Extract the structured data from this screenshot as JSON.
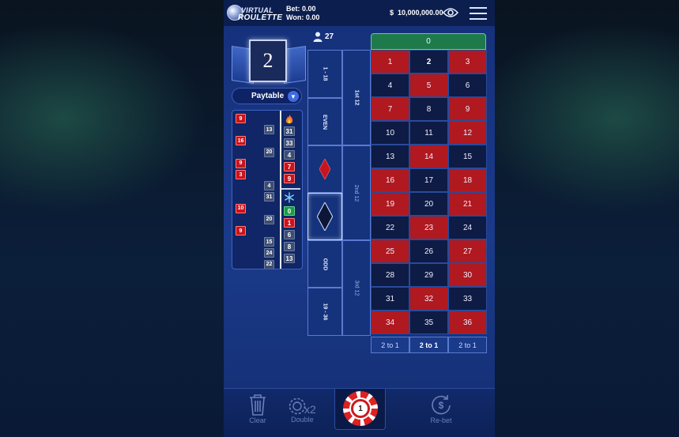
{
  "header": {
    "logo_line1": "VIRTUAL",
    "logo_line2": "ROULETTE",
    "bet_label": "Bet: 0.00",
    "won_label": "Won: 0.00",
    "currency": "$",
    "balance": "10,000,000.00"
  },
  "last_result": "2",
  "paytable_label": "Paytable",
  "players_count": "27",
  "history": [
    {
      "value": "9",
      "color": "red",
      "col": 0
    },
    {
      "value": "13",
      "color": "black",
      "col": 2
    },
    {
      "value": "16",
      "color": "red",
      "col": 0
    },
    {
      "value": "20",
      "color": "black",
      "col": 2
    },
    {
      "value": "9",
      "color": "red",
      "col": 0
    },
    {
      "value": "3",
      "color": "red",
      "col": 0
    },
    {
      "value": "4",
      "color": "black",
      "col": 2
    },
    {
      "value": "31",
      "color": "black",
      "col": 2
    },
    {
      "value": "10",
      "color": "red",
      "col": 0
    },
    {
      "value": "20",
      "color": "black",
      "col": 2
    },
    {
      "value": "9",
      "color": "red",
      "col": 0
    },
    {
      "value": "15",
      "color": "black",
      "col": 2
    },
    {
      "value": "24",
      "color": "black",
      "col": 2
    },
    {
      "value": "22",
      "color": "black",
      "col": 2
    }
  ],
  "hot_numbers": [
    {
      "value": "31",
      "color": "black"
    },
    {
      "value": "33",
      "color": "black"
    },
    {
      "value": "4",
      "color": "black"
    },
    {
      "value": "7",
      "color": "red"
    },
    {
      "value": "9",
      "color": "red"
    }
  ],
  "cold_numbers": [
    {
      "value": "0",
      "color": "green"
    },
    {
      "value": "1",
      "color": "red"
    },
    {
      "value": "6",
      "color": "black"
    },
    {
      "value": "8",
      "color": "black"
    },
    {
      "value": "13",
      "color": "black"
    }
  ],
  "board": {
    "zero": "0",
    "outside_left": [
      "1 - 18",
      "EVEN",
      "",
      "",
      "ODD",
      "19 - 36"
    ],
    "dozens": [
      "1st 12",
      "2nd 12",
      "3rd 12"
    ],
    "numbers": [
      {
        "n": "1",
        "c": "red"
      },
      {
        "n": "2",
        "c": "black"
      },
      {
        "n": "3",
        "c": "red"
      },
      {
        "n": "4",
        "c": "black"
      },
      {
        "n": "5",
        "c": "red"
      },
      {
        "n": "6",
        "c": "black"
      },
      {
        "n": "7",
        "c": "red"
      },
      {
        "n": "8",
        "c": "black"
      },
      {
        "n": "9",
        "c": "red"
      },
      {
        "n": "10",
        "c": "black"
      },
      {
        "n": "11",
        "c": "black"
      },
      {
        "n": "12",
        "c": "red"
      },
      {
        "n": "13",
        "c": "black"
      },
      {
        "n": "14",
        "c": "red"
      },
      {
        "n": "15",
        "c": "black"
      },
      {
        "n": "16",
        "c": "red"
      },
      {
        "n": "17",
        "c": "black"
      },
      {
        "n": "18",
        "c": "red"
      },
      {
        "n": "19",
        "c": "red"
      },
      {
        "n": "20",
        "c": "black"
      },
      {
        "n": "21",
        "c": "red"
      },
      {
        "n": "22",
        "c": "black"
      },
      {
        "n": "23",
        "c": "red"
      },
      {
        "n": "24",
        "c": "black"
      },
      {
        "n": "25",
        "c": "red"
      },
      {
        "n": "26",
        "c": "black"
      },
      {
        "n": "27",
        "c": "red"
      },
      {
        "n": "28",
        "c": "black"
      },
      {
        "n": "29",
        "c": "black"
      },
      {
        "n": "30",
        "c": "red"
      },
      {
        "n": "31",
        "c": "black"
      },
      {
        "n": "32",
        "c": "red"
      },
      {
        "n": "33",
        "c": "black"
      },
      {
        "n": "34",
        "c": "red"
      },
      {
        "n": "35",
        "c": "black"
      },
      {
        "n": "36",
        "c": "red"
      }
    ],
    "column_bets": [
      "2 to 1",
      "2 to 1",
      "2 to 1"
    ]
  },
  "bottom": {
    "clear_label": "Clear",
    "double_label": "Double",
    "double_icon_text": "x2",
    "chip_value": "1",
    "rebet_label": "Re-bet"
  },
  "colors": {
    "red": "#b0191f",
    "black": "#0e1b44",
    "green": "#1f7a4b",
    "accent": "#3e6be0"
  }
}
